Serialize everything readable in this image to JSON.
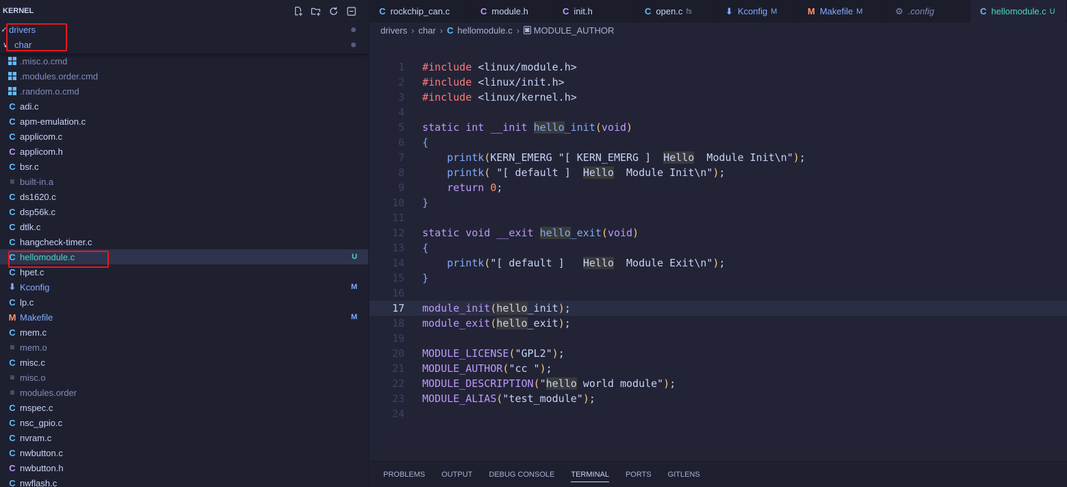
{
  "sidebar": {
    "title": "KERNEL",
    "sticky": [
      {
        "label": "drivers",
        "chevron": "✓",
        "indent": 13
      },
      {
        "label": "char",
        "chevron": "∨",
        "indent": 21
      }
    ],
    "files": [
      {
        "name": ".misc.o.cmd",
        "icon": "windows-icon",
        "glyph": "win",
        "color": "#828bb8",
        "iconColor": "#65bcff",
        "badge": ""
      },
      {
        "name": ".modules.order.cmd",
        "icon": "windows-icon",
        "glyph": "win",
        "color": "#828bb8",
        "iconColor": "#65bcff",
        "badge": ""
      },
      {
        "name": ".random.o.cmd",
        "icon": "windows-icon",
        "glyph": "win",
        "color": "#828bb8",
        "iconColor": "#65bcff",
        "badge": ""
      },
      {
        "name": "adi.c",
        "icon": "c-file-icon",
        "glyph": "C",
        "color": "#c8d3f5",
        "iconColor": "#65bcff",
        "badge": ""
      },
      {
        "name": "apm-emulation.c",
        "icon": "c-file-icon",
        "glyph": "C",
        "color": "#c8d3f5",
        "iconColor": "#65bcff",
        "badge": ""
      },
      {
        "name": "applicom.c",
        "icon": "c-file-icon",
        "glyph": "C",
        "color": "#c8d3f5",
        "iconColor": "#65bcff",
        "badge": ""
      },
      {
        "name": "applicom.h",
        "icon": "h-file-icon",
        "glyph": "C",
        "color": "#c8d3f5",
        "iconColor": "#c099ff",
        "badge": ""
      },
      {
        "name": "bsr.c",
        "icon": "c-file-icon",
        "glyph": "C",
        "color": "#c8d3f5",
        "iconColor": "#65bcff",
        "badge": ""
      },
      {
        "name": "built-in.a",
        "icon": "text-file-icon",
        "glyph": "≡",
        "color": "#828bb8",
        "iconColor": "#828bb8",
        "badge": ""
      },
      {
        "name": "ds1620.c",
        "icon": "c-file-icon",
        "glyph": "C",
        "color": "#c8d3f5",
        "iconColor": "#65bcff",
        "badge": ""
      },
      {
        "name": "dsp56k.c",
        "icon": "c-file-icon",
        "glyph": "C",
        "color": "#c8d3f5",
        "iconColor": "#65bcff",
        "badge": ""
      },
      {
        "name": "dtlk.c",
        "icon": "c-file-icon",
        "glyph": "C",
        "color": "#c8d3f5",
        "iconColor": "#65bcff",
        "badge": ""
      },
      {
        "name": "hangcheck-timer.c",
        "icon": "c-file-icon",
        "glyph": "C",
        "color": "#c8d3f5",
        "iconColor": "#65bcff",
        "badge": ""
      },
      {
        "name": "hellomodule.c",
        "icon": "c-file-icon",
        "glyph": "C",
        "color": "#4fd6be",
        "iconColor": "#65bcff",
        "badge": "U",
        "badgeColor": "#4fd6be",
        "selected": true
      },
      {
        "name": "hpet.c",
        "icon": "c-file-icon",
        "glyph": "C",
        "color": "#c8d3f5",
        "iconColor": "#65bcff",
        "badge": ""
      },
      {
        "name": "Kconfig",
        "icon": "kconfig-icon",
        "glyph": "⬇",
        "color": "#82aaff",
        "iconColor": "#82aaff",
        "badge": "M",
        "badgeColor": "#82aaff"
      },
      {
        "name": "lp.c",
        "icon": "c-file-icon",
        "glyph": "C",
        "color": "#c8d3f5",
        "iconColor": "#65bcff",
        "badge": ""
      },
      {
        "name": "Makefile",
        "icon": "makefile-icon",
        "glyph": "M",
        "color": "#82aaff",
        "iconColor": "#ff966c",
        "badge": "M",
        "badgeColor": "#82aaff"
      },
      {
        "name": "mem.c",
        "icon": "c-file-icon",
        "glyph": "C",
        "color": "#c8d3f5",
        "iconColor": "#65bcff",
        "badge": ""
      },
      {
        "name": "mem.o",
        "icon": "text-file-icon",
        "glyph": "≡",
        "color": "#828bb8",
        "iconColor": "#828bb8",
        "badge": ""
      },
      {
        "name": "misc.c",
        "icon": "c-file-icon",
        "glyph": "C",
        "color": "#c8d3f5",
        "iconColor": "#65bcff",
        "badge": ""
      },
      {
        "name": "misc.o",
        "icon": "text-file-icon",
        "glyph": "≡",
        "color": "#828bb8",
        "iconColor": "#828bb8",
        "badge": ""
      },
      {
        "name": "modules.order",
        "icon": "text-file-icon",
        "glyph": "≡",
        "color": "#828bb8",
        "iconColor": "#828bb8",
        "badge": ""
      },
      {
        "name": "mspec.c",
        "icon": "c-file-icon",
        "glyph": "C",
        "color": "#c8d3f5",
        "iconColor": "#65bcff",
        "badge": ""
      },
      {
        "name": "nsc_gpio.c",
        "icon": "c-file-icon",
        "glyph": "C",
        "color": "#c8d3f5",
        "iconColor": "#65bcff",
        "badge": ""
      },
      {
        "name": "nvram.c",
        "icon": "c-file-icon",
        "glyph": "C",
        "color": "#c8d3f5",
        "iconColor": "#65bcff",
        "badge": ""
      },
      {
        "name": "nwbutton.c",
        "icon": "c-file-icon",
        "glyph": "C",
        "color": "#c8d3f5",
        "iconColor": "#65bcff",
        "badge": ""
      },
      {
        "name": "nwbutton.h",
        "icon": "h-file-icon",
        "glyph": "C",
        "color": "#c8d3f5",
        "iconColor": "#c099ff",
        "badge": ""
      },
      {
        "name": "nwflash.c",
        "icon": "c-file-icon",
        "glyph": "C",
        "color": "#c8d3f5",
        "iconColor": "#65bcff",
        "badge": ""
      }
    ]
  },
  "tabs": [
    {
      "label": "rockchip_can.c",
      "icon": "c-file-icon",
      "glyph": "C",
      "iconColor": "#65bcff",
      "color": "#c8d3f5",
      "suffix": "",
      "width": 148
    },
    {
      "label": "module.h",
      "icon": "h-file-icon",
      "glyph": "C",
      "iconColor": "#c099ff",
      "color": "#c8d3f5",
      "suffix": "",
      "width": 120
    },
    {
      "label": "init.h",
      "icon": "h-file-icon",
      "glyph": "C",
      "iconColor": "#c099ff",
      "color": "#c8d3f5",
      "suffix": "",
      "width": 120
    },
    {
      "label": "open.c",
      "icon": "c-file-icon",
      "glyph": "C",
      "iconColor": "#65bcff",
      "color": "#c8d3f5",
      "suffix": "fs",
      "width": 118
    },
    {
      "label": "Kconfig",
      "icon": "kconfig-icon",
      "glyph": "⬇",
      "iconColor": "#82aaff",
      "color": "#82aaff",
      "suffix": "M",
      "width": 120
    },
    {
      "label": "Makefile",
      "icon": "makefile-icon",
      "glyph": "M",
      "iconColor": "#ff966c",
      "color": "#82aaff",
      "suffix": "M",
      "width": 128
    },
    {
      "label": ".config",
      "icon": "gear-icon",
      "glyph": "⚙",
      "iconColor": "#828bb8",
      "color": "#828bb8",
      "suffix": "",
      "width": 124,
      "italic": true
    },
    {
      "label": "hellomodule.c",
      "icon": "c-file-icon",
      "glyph": "C",
      "iconColor": "#65bcff",
      "color": "#4fd6be",
      "suffix": "U",
      "width": 141,
      "active": true
    }
  ],
  "breadcrumb": {
    "parts": [
      "drivers",
      "char"
    ],
    "file": "hellomodule.c",
    "symbol": "MODULE_AUTHOR"
  },
  "editor": {
    "current_line": 17,
    "lines": [
      {
        "n": "1",
        "tokens": [
          [
            "pp",
            "#include"
          ],
          [
            "plain",
            " "
          ],
          [
            "str2",
            "<linux/module.h>"
          ]
        ]
      },
      {
        "n": "2",
        "tokens": [
          [
            "pp",
            "#include"
          ],
          [
            "plain",
            " "
          ],
          [
            "str2",
            "<linux/init.h>"
          ]
        ]
      },
      {
        "n": "3",
        "tokens": [
          [
            "pp",
            "#include"
          ],
          [
            "plain",
            " "
          ],
          [
            "str2",
            "<linux/kernel.h>"
          ]
        ]
      },
      {
        "n": "4",
        "tokens": []
      },
      {
        "n": "5",
        "tokens": [
          [
            "kw",
            "static"
          ],
          [
            "plain",
            " "
          ],
          [
            "kw",
            "int"
          ],
          [
            "plain",
            " "
          ],
          [
            "kw",
            "__init"
          ],
          [
            "plain",
            " "
          ],
          [
            "fnh",
            "hello"
          ],
          [
            "fn",
            "_init"
          ],
          [
            "par",
            "("
          ],
          [
            "kw",
            "void"
          ],
          [
            "par",
            ")"
          ]
        ]
      },
      {
        "n": "6",
        "tokens": [
          [
            "brc",
            "{"
          ]
        ]
      },
      {
        "n": "7",
        "tokens": [
          [
            "plain",
            "    "
          ],
          [
            "fn",
            "printk"
          ],
          [
            "par",
            "("
          ],
          [
            "plain",
            "KERN_EMERG "
          ],
          [
            "str2",
            "\"[ KERN_EMERG ]  "
          ],
          [
            "strh",
            "Hello"
          ],
          [
            "str2",
            "  Module Init\\n\""
          ],
          [
            "par",
            ")"
          ],
          [
            "plain",
            ";"
          ]
        ]
      },
      {
        "n": "8",
        "tokens": [
          [
            "plain",
            "    "
          ],
          [
            "fn",
            "printk"
          ],
          [
            "par",
            "("
          ],
          [
            "plain",
            " "
          ],
          [
            "str2",
            "\"[ default ]  "
          ],
          [
            "strh",
            "Hello"
          ],
          [
            "str2",
            "  Module Init\\n\""
          ],
          [
            "par",
            ")"
          ],
          [
            "plain",
            ";"
          ]
        ]
      },
      {
        "n": "9",
        "tokens": [
          [
            "plain",
            "    "
          ],
          [
            "kw",
            "return"
          ],
          [
            "plain",
            " "
          ],
          [
            "num",
            "0"
          ],
          [
            "plain",
            ";"
          ]
        ]
      },
      {
        "n": "10",
        "tokens": [
          [
            "brc",
            "}"
          ]
        ]
      },
      {
        "n": "11",
        "tokens": []
      },
      {
        "n": "12",
        "tokens": [
          [
            "kw",
            "static"
          ],
          [
            "plain",
            " "
          ],
          [
            "kw",
            "void"
          ],
          [
            "plain",
            " "
          ],
          [
            "kw",
            "__exit"
          ],
          [
            "plain",
            " "
          ],
          [
            "fnh",
            "hello"
          ],
          [
            "fn",
            "_exit"
          ],
          [
            "par",
            "("
          ],
          [
            "kw",
            "void"
          ],
          [
            "par",
            ")"
          ]
        ]
      },
      {
        "n": "13",
        "tokens": [
          [
            "brc",
            "{"
          ]
        ]
      },
      {
        "n": "14",
        "tokens": [
          [
            "plain",
            "    "
          ],
          [
            "fn",
            "printk"
          ],
          [
            "par",
            "("
          ],
          [
            "str2",
            "\"[ default ]   "
          ],
          [
            "strh",
            "Hello"
          ],
          [
            "str2",
            "  Module Exit\\n\""
          ],
          [
            "par",
            ")"
          ],
          [
            "plain",
            ";"
          ]
        ]
      },
      {
        "n": "15",
        "tokens": [
          [
            "brc",
            "}"
          ]
        ]
      },
      {
        "n": "16",
        "tokens": []
      },
      {
        "n": "17",
        "tokens": [
          [
            "mac",
            "module_init"
          ],
          [
            "par",
            "("
          ],
          [
            "plainh",
            "hello"
          ],
          [
            "plain",
            "_init"
          ],
          [
            "par",
            ")"
          ],
          [
            "plain",
            ";"
          ]
        ]
      },
      {
        "n": "18",
        "tokens": [
          [
            "mac",
            "module_exit"
          ],
          [
            "par",
            "("
          ],
          [
            "plainh",
            "hello"
          ],
          [
            "plain",
            "_exit"
          ],
          [
            "par",
            ")"
          ],
          [
            "plain",
            ";"
          ]
        ]
      },
      {
        "n": "19",
        "tokens": []
      },
      {
        "n": "20",
        "tokens": [
          [
            "mac",
            "MODULE_LICENSE"
          ],
          [
            "par",
            "("
          ],
          [
            "str2",
            "\"GPL2\""
          ],
          [
            "par",
            ")"
          ],
          [
            "plain",
            ";"
          ]
        ]
      },
      {
        "n": "21",
        "tokens": [
          [
            "mac",
            "MODULE_AUTHOR"
          ],
          [
            "par",
            "("
          ],
          [
            "str2",
            "\"cc \""
          ],
          [
            "par",
            ")"
          ],
          [
            "plain",
            ";"
          ]
        ]
      },
      {
        "n": "22",
        "tokens": [
          [
            "mac",
            "MODULE_DESCRIPTION"
          ],
          [
            "par",
            "("
          ],
          [
            "str2",
            "\""
          ],
          [
            "strh",
            "hello"
          ],
          [
            "str2",
            " world module\""
          ],
          [
            "par",
            ")"
          ],
          [
            "plain",
            ";"
          ]
        ]
      },
      {
        "n": "23",
        "tokens": [
          [
            "mac",
            "MODULE_ALIAS"
          ],
          [
            "par",
            "("
          ],
          [
            "str2",
            "\"test_module\""
          ],
          [
            "par",
            ")"
          ],
          [
            "plain",
            ";"
          ]
        ]
      },
      {
        "n": "24",
        "tokens": []
      }
    ]
  },
  "panel": {
    "tabs": [
      "PROBLEMS",
      "OUTPUT",
      "DEBUG CONSOLE",
      "TERMINAL",
      "PORTS",
      "GITLENS"
    ],
    "active": "TERMINAL"
  },
  "colors": {
    "highlight_box": "#e51a1a",
    "untracked": "#4fd6be",
    "modified": "#82aaff"
  }
}
